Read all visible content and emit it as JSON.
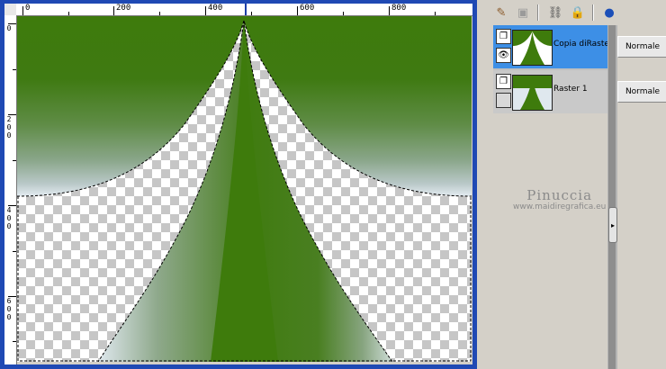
{
  "canvas": {
    "ruler": {
      "top_labels": [
        "0",
        "200",
        "400",
        "600",
        "800"
      ],
      "left_labels": [
        [
          "0"
        ],
        [
          "2",
          "0",
          "0"
        ],
        [
          "4",
          "0",
          "0"
        ],
        [
          "6",
          "0",
          "0"
        ]
      ]
    }
  },
  "toolbar": {
    "icons": [
      "brush-wand-icon",
      "layer-mask-icon",
      "link-icon",
      "lock-icon",
      "globe-ball-icon"
    ]
  },
  "layers": [
    {
      "name": "Copia diRaster",
      "blend": "Normale",
      "selected": true,
      "visible": true
    },
    {
      "name": "Raster 1",
      "blend": "Normale",
      "selected": false,
      "visible": false
    }
  ],
  "watermark": {
    "name": "Pinuccia",
    "site": "www.maidiregrafica.eu"
  },
  "colors": {
    "accent": "#3d8fe6",
    "canvas_frame": "#1f49b4",
    "image_green": "#3e7b0c"
  }
}
